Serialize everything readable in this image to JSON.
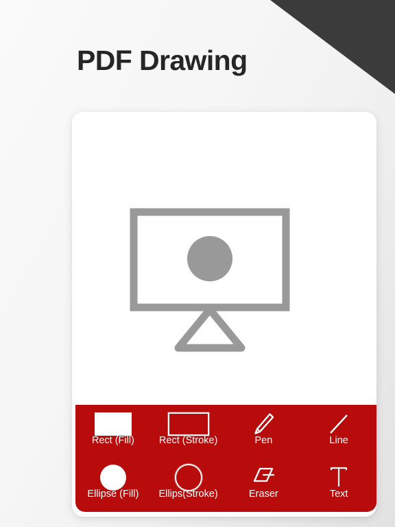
{
  "header": {
    "title": "PDF Drawing"
  },
  "colors": {
    "toolbar_red": "#b80c0c",
    "corner_dark": "#3b3b3b",
    "illustration_gray": "#999999",
    "title_text": "#262626",
    "icon_white": "#ffffff"
  },
  "canvas": {
    "illustration_name": "presentation-easel",
    "shapes": [
      {
        "type": "rectangle",
        "style": "stroke"
      },
      {
        "type": "circle",
        "style": "fill"
      },
      {
        "type": "triangle",
        "style": "stroke"
      }
    ]
  },
  "toolbar": {
    "rows": [
      {
        "tools": [
          {
            "label": "Rect (Fill)",
            "icon": "rect-fill-icon"
          },
          {
            "label": "Rect (Stroke)",
            "icon": "rect-stroke-icon"
          },
          {
            "label": "Pen",
            "icon": "pen-icon"
          },
          {
            "label": "Line",
            "icon": "line-icon"
          }
        ]
      },
      {
        "tools": [
          {
            "label": "Ellipse (Fill)",
            "icon": "ellipse-fill-icon"
          },
          {
            "label": "Ellips(Stroke)",
            "icon": "ellipse-stroke-icon"
          },
          {
            "label": "Eraser",
            "icon": "eraser-icon"
          },
          {
            "label": "Text",
            "icon": "text-icon"
          }
        ]
      }
    ]
  }
}
